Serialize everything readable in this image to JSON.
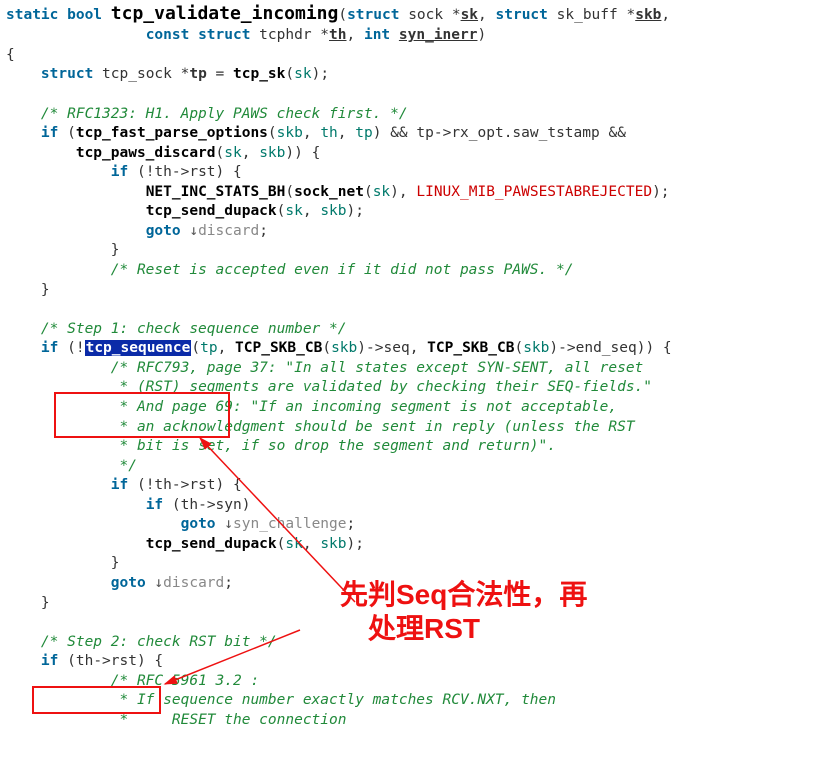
{
  "func": {
    "modifiers": "static bool",
    "name": "tcp_validate_incoming",
    "params": {
      "p1_type": "struct sock *",
      "p1_name": "sk",
      "p2_type": "struct sk_buff *",
      "p2_name": "skb",
      "p3_type": "const struct tcphdr *",
      "p3_name": "th",
      "p4_type": "int",
      "p4_name": "syn_inerr"
    }
  },
  "decl": {
    "type": "struct tcp_sock *",
    "var": "tp",
    "init_call": "tcp_sk",
    "init_arg": "sk"
  },
  "cmt_paws": "/* RFC1323: H1. Apply PAWS check first. */",
  "line_paws_if": {
    "kw_if": "if",
    "call1": "tcp_fast_parse_options",
    "a1": "skb",
    "a2": "th",
    "a3": "tp",
    "op_and": "&&",
    "expr_rx": "tp->rx_opt.saw_tstamp",
    "op_and2": "&&"
  },
  "line_paws_discard": {
    "call": "tcp_paws_discard",
    "a1": "sk",
    "a2": "skb"
  },
  "line_not_rst": {
    "kw_if": "if",
    "expr": "!th->rst"
  },
  "line_netinc": {
    "call": "NET_INC_STATS_BH",
    "inner_call": "sock_net",
    "inner_arg": "sk",
    "enumv": "LINUX_MIB_PAWSESTABREJECTED"
  },
  "line_dupack": {
    "call": "tcp_send_dupack",
    "a1": "sk",
    "a2": "skb"
  },
  "line_goto_discard": {
    "kw": "goto",
    "arrow": "↓",
    "label": "discard"
  },
  "cmt_reset_paws": "/* Reset is accepted even if it did not pass PAWS. */",
  "cmt_step1": "/* Step 1: check sequence number */",
  "line_seq_if": {
    "kw_if": "if",
    "bang": "!",
    "call": "tcp_sequence",
    "a1": "tp",
    "cb": "TCP_SKB_CB",
    "cb_arg": "skb",
    "mem1": "seq",
    "mem2": "end_seq"
  },
  "cmt_seq_1": "/* RFC793, page 37: \"In all states except SYN-SENT, all reset",
  "cmt_seq_2": " * (RST) segments are validated by checking their SEQ-fields.\"",
  "cmt_seq_3": " * And page 69: \"If an incoming segment is not acceptable,",
  "cmt_seq_4": " * an acknowledgment should be sent in reply (unless the RST",
  "cmt_seq_5": " * bit is set, if so drop the segment and return)\".",
  "cmt_seq_6": " */",
  "line_not_rst2": {
    "kw_if": "if",
    "expr": "!th->rst"
  },
  "line_if_syn": {
    "kw_if": "if",
    "expr": "th->syn"
  },
  "line_goto_syn": {
    "kw": "goto",
    "arrow": "↓",
    "label": "syn_challenge"
  },
  "line_dupack2": {
    "call": "tcp_send_dupack",
    "a1": "sk",
    "a2": "skb"
  },
  "line_goto_discard2": {
    "kw": "goto",
    "arrow": "↓",
    "label": "discard"
  },
  "cmt_step2": "/* Step 2: check RST bit */",
  "line_if_rst": {
    "kw_if": "if",
    "expr": "th->rst"
  },
  "cmt_rfc5961_1": "/* RFC 5961 3.2 :",
  "cmt_rfc5961_2": " * If sequence number exactly matches RCV.NXT, then",
  "cmt_rfc5961_3": " *     RESET the connection",
  "annotation": {
    "line1": "先判Seq合法性，再",
    "line2": "处理RST"
  },
  "annotation_colors": {
    "box": "#e11",
    "text": "#e11",
    "arrow": "#e11"
  }
}
